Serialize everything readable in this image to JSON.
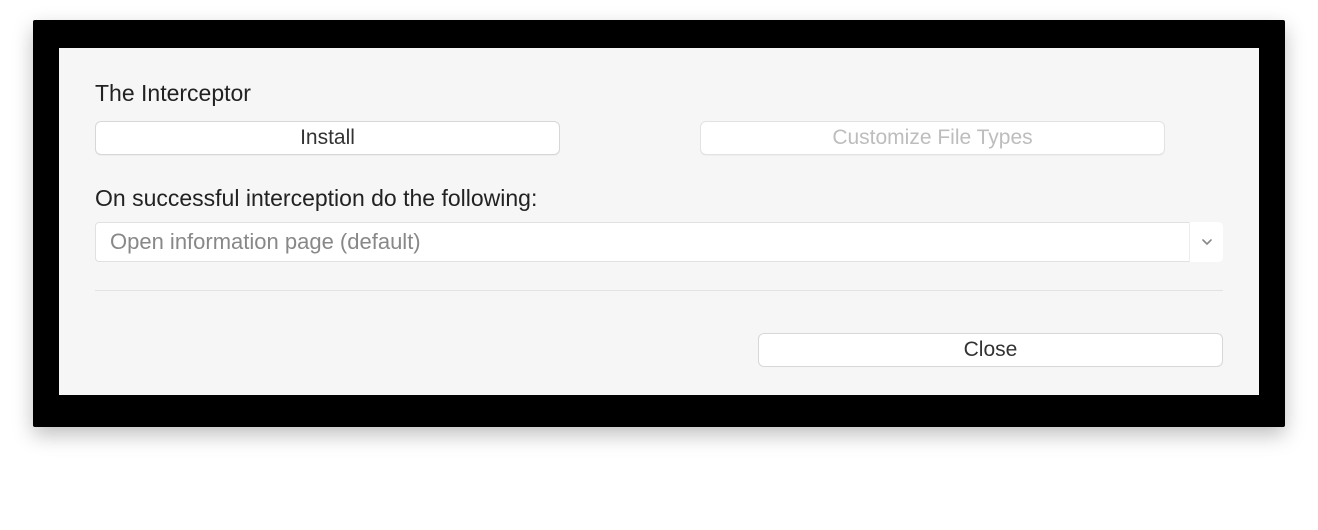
{
  "section_title": "The Interceptor",
  "buttons": {
    "install_label": "Install",
    "customize_label": "Customize File Types",
    "close_label": "Close"
  },
  "instruction_label": "On successful interception do the following:",
  "dropdown": {
    "selected": "Open information page (default)"
  }
}
